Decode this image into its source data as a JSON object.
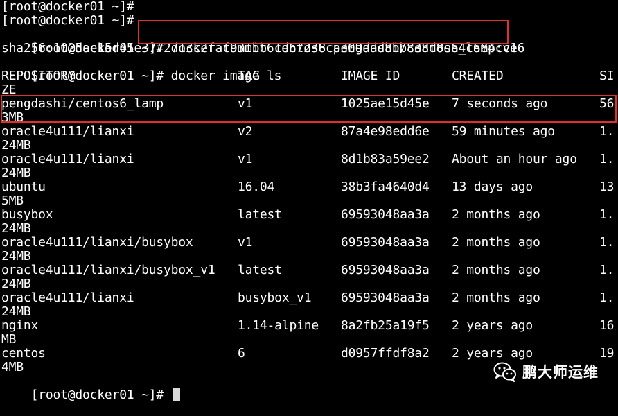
{
  "terminal": {
    "prompt": "[root@docker01 ~]#",
    "lines_before": [
      "[root@docker01 ~]#",
      "[root@docker01 ~]#"
    ],
    "commit_command": "docker commit centos6 pengdashi/centos6_lamp:v1",
    "commit_output": "sha256:1025ae15d45e3772713c2faf931bb61d67238ca309add8bb838d8ea4c684cce6",
    "images_command": "docker image ls",
    "headers": {
      "repository": "REPOSITORY",
      "tag": "TAG",
      "image_id": "IMAGE ID",
      "created": "CREATED",
      "size_part1": "SI",
      "size_part2": "ZE"
    },
    "rows": [
      {
        "repository": "pengdashi/centos6_lamp",
        "tag": "v1",
        "image_id": "1025ae15d45e",
        "created": "7 seconds ago",
        "size_a": "56",
        "size_b": "3MB"
      },
      {
        "repository": "oracle4u111/lianxi",
        "tag": "v2",
        "image_id": "87a4e98edd6e",
        "created": "59 minutes ago",
        "size_a": "1.",
        "size_b": "24MB"
      },
      {
        "repository": "oracle4u111/lianxi",
        "tag": "v1",
        "image_id": "8d1b83a59ee2",
        "created": "About an hour ago",
        "size_a": "1.",
        "size_b": "24MB"
      },
      {
        "repository": "ubuntu",
        "tag": "16.04",
        "image_id": "38b3fa4640d4",
        "created": "13 days ago",
        "size_a": "13",
        "size_b": "5MB"
      },
      {
        "repository": "busybox",
        "tag": "latest",
        "image_id": "69593048aa3a",
        "created": "2 months ago",
        "size_a": "1.",
        "size_b": "24MB"
      },
      {
        "repository": "oracle4u111/lianxi/busybox",
        "tag": "v1",
        "image_id": "69593048aa3a",
        "created": "2 months ago",
        "size_a": "1.",
        "size_b": "24MB"
      },
      {
        "repository": "oracle4u111/lianxi/busybox_v1",
        "tag": "latest",
        "image_id": "69593048aa3a",
        "created": "2 months ago",
        "size_a": "1.",
        "size_b": "24MB"
      },
      {
        "repository": "oracle4u111/lianxi",
        "tag": "busybox_v1",
        "image_id": "69593048aa3a",
        "created": "2 months ago",
        "size_a": "1.",
        "size_b": "24MB"
      },
      {
        "repository": "nginx",
        "tag": "1.14-alpine",
        "image_id": "8a2fb25a19f5",
        "created": "2 years ago",
        "size_a": "16",
        "size_b": "MB"
      },
      {
        "repository": "centos",
        "tag": "6",
        "image_id": "d0957ffdf8a2",
        "created": "2 years ago",
        "size_a": "19",
        "size_b": "4MB"
      }
    ],
    "final_prompt": "[root@docker01 ~]#"
  },
  "watermark": {
    "text": "鹏大师运维",
    "icon": "wechat-icon"
  },
  "colors": {
    "background": "#000000",
    "text": "#ffffff",
    "highlight_box": "#e0302b"
  }
}
